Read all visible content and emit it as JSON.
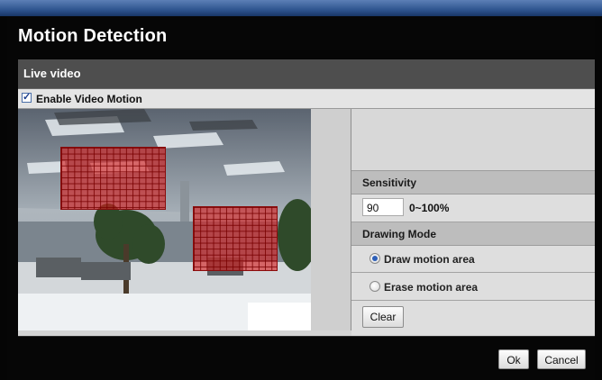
{
  "dialog": {
    "title": "Motion Detection",
    "section_title": "Live video"
  },
  "enable_motion": {
    "label": "Enable Video Motion",
    "checked": true,
    "check_glyph": "✓"
  },
  "sensitivity": {
    "label": "Sensitivity",
    "value": "90",
    "range_text": "0~100%"
  },
  "drawing_mode": {
    "label": "Drawing Mode",
    "options": [
      {
        "label": "Draw motion area",
        "selected": true
      },
      {
        "label": "Erase motion area",
        "selected": false
      }
    ]
  },
  "buttons": {
    "clear": "Clear",
    "ok": "Ok",
    "cancel": "Cancel"
  },
  "colors": {
    "motion_area": "#d61e1e",
    "title_bar": "#2f558f",
    "radio_selected": "#2d5fb8"
  }
}
